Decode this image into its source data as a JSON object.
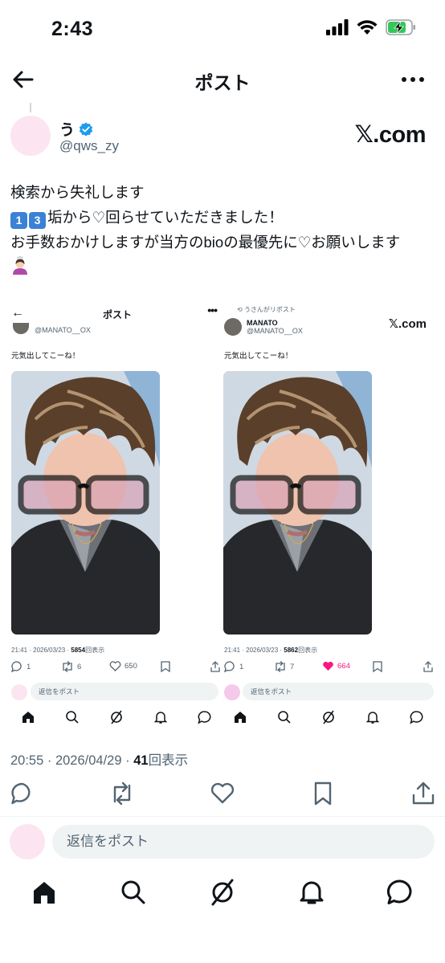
{
  "status_bar": {
    "time": "2:43"
  },
  "header": {
    "title": "ポスト"
  },
  "author": {
    "name": "う",
    "handle": "@qws_zy",
    "brand": "𝕏.com"
  },
  "tweet": {
    "line1": "検索から失礼します",
    "keycap1": "1",
    "keycap2": "3",
    "line2": "垢から♡回らせていただきました！",
    "line3": "お手数おかけしますが当方のbioの最優先に♡お願いします"
  },
  "embedded": {
    "left": {
      "title": "ポスト",
      "handle": "@MANATO__OX",
      "text": "元気出してこーね！",
      "timestamp": "21:41 · 2026/03/23 · ",
      "views": "5854",
      "views_suffix": "回表示",
      "replies": "1",
      "reposts": "6",
      "likes": "650",
      "reply_placeholder": "返信をポスト"
    },
    "right": {
      "repost_note": "うさんがリポスト",
      "name": "MANATO",
      "handle": "@MANATO__OX",
      "brand": "𝕏.com",
      "text": "元気出してこーね！",
      "timestamp": "21:41 · 2026/03/23 · ",
      "views": "5862",
      "views_suffix": "回表示",
      "replies": "1",
      "reposts": "7",
      "likes": "664",
      "reply_placeholder": "返信をポスト"
    }
  },
  "meta": {
    "timestamp": "20:55 · 2026/04/29 · ",
    "views": "41",
    "views_suffix": "回表示"
  },
  "reply": {
    "placeholder": "返信をポスト"
  },
  "colors": {
    "like_active": "#f91880",
    "verified": "#1d9bf0",
    "muted": "#536471"
  }
}
